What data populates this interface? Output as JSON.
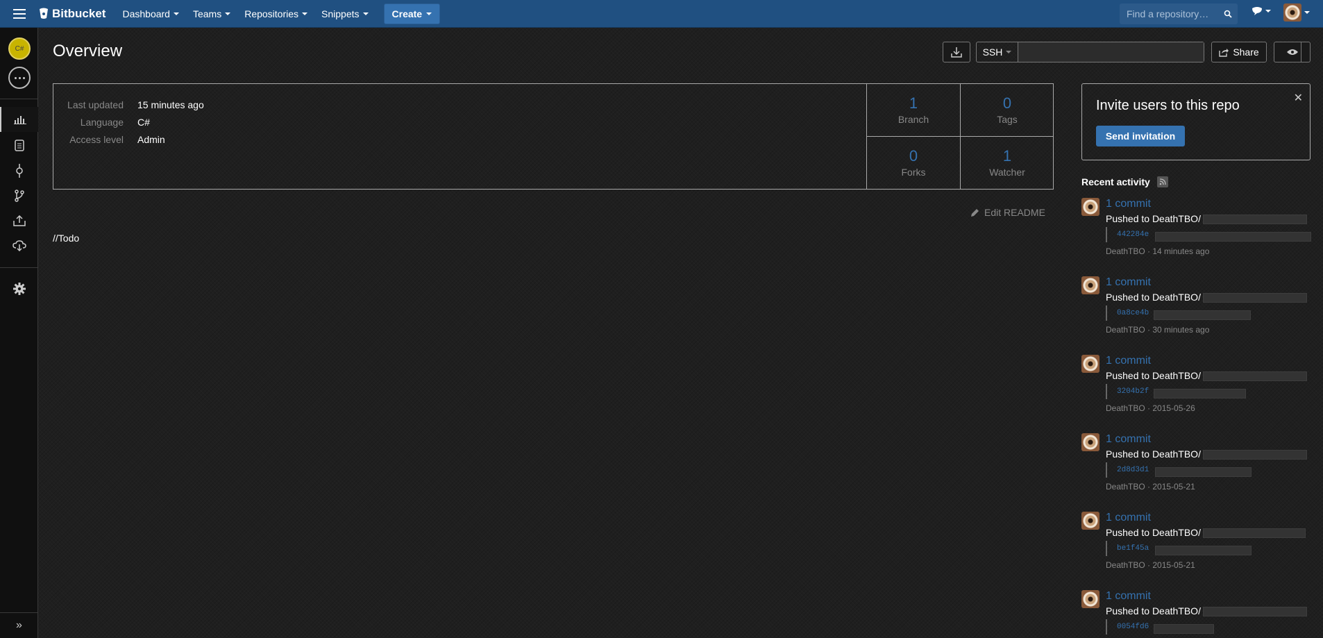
{
  "nav": {
    "brand": "Bitbucket",
    "items": [
      {
        "label": "Dashboard"
      },
      {
        "label": "Teams"
      },
      {
        "label": "Repositories"
      },
      {
        "label": "Snippets"
      }
    ],
    "create_label": "Create",
    "search_placeholder": "Find a repository…"
  },
  "sidebar": {
    "repo_avatar_text": "C#",
    "icons": [
      "overview-icon",
      "source-icon",
      "commits-icon",
      "branches-icon",
      "pull-requests-icon",
      "downloads-icon",
      "settings-icon"
    ]
  },
  "main": {
    "title": "Overview",
    "clone": {
      "protocol": "SSH",
      "url": ""
    },
    "share_label": "Share",
    "meta": [
      {
        "label": "Last updated",
        "value": "15 minutes ago"
      },
      {
        "label": "Language",
        "value": "C#"
      },
      {
        "label": "Access level",
        "value": "Admin"
      }
    ],
    "stats": [
      {
        "value": "1",
        "label": "Branch"
      },
      {
        "value": "0",
        "label": "Tags"
      },
      {
        "value": "0",
        "label": "Forks"
      },
      {
        "value": "1",
        "label": "Watcher"
      }
    ],
    "edit_readme_label": "Edit README",
    "readme_text": "//Todo"
  },
  "right": {
    "invite": {
      "title": "Invite users to this repo",
      "button": "Send invitation"
    },
    "recent_title": "Recent activity",
    "activities": [
      {
        "link": "1 commit",
        "text": "Pushed to DeathTBO/",
        "hash": "442284e",
        "meta": "DeathTBO · 14 minutes ago"
      },
      {
        "link": "1 commit",
        "text": "Pushed to DeathTBO/",
        "hash": "0a8ce4b",
        "meta": "DeathTBO · 30 minutes ago"
      },
      {
        "link": "1 commit",
        "text": "Pushed to DeathTBO/",
        "hash": "3204b2f",
        "meta": "DeathTBO · 2015-05-26"
      },
      {
        "link": "1 commit",
        "text": "Pushed to DeathTBO/",
        "hash": "2d8d3d1",
        "meta": "DeathTBO · 2015-05-21"
      },
      {
        "link": "1 commit",
        "text": "Pushed to DeathTBO/",
        "hash": "be1f45a",
        "meta": "DeathTBO · 2015-05-21"
      },
      {
        "link": "1 commit",
        "text": "Pushed to DeathTBO/",
        "hash": "0054fd6",
        "meta": ""
      }
    ]
  },
  "colors": {
    "nav_bg": "#205081",
    "link": "#3572b0",
    "page_bg": "#1f1f1f"
  }
}
